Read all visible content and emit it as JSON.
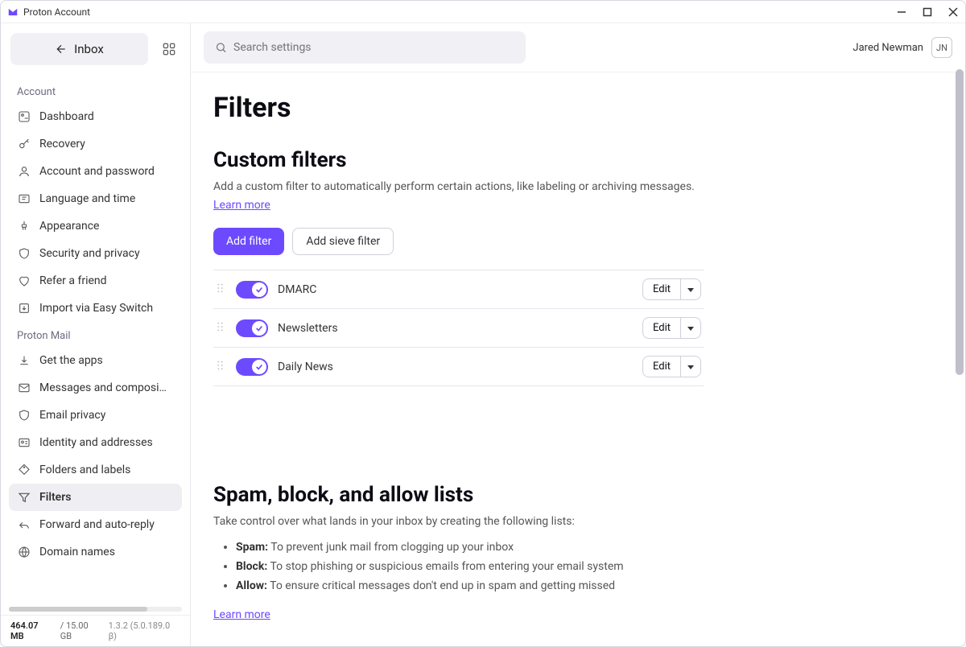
{
  "titlebar": {
    "app_name": "Proton Account"
  },
  "sidebar": {
    "inbox_label": "Inbox",
    "sections": {
      "account": {
        "title": "Account",
        "items": [
          {
            "id": "dashboard",
            "label": "Dashboard"
          },
          {
            "id": "recovery",
            "label": "Recovery"
          },
          {
            "id": "account-password",
            "label": "Account and password"
          },
          {
            "id": "language-time",
            "label": "Language and time"
          },
          {
            "id": "appearance",
            "label": "Appearance"
          },
          {
            "id": "security-privacy",
            "label": "Security and privacy"
          },
          {
            "id": "refer",
            "label": "Refer a friend"
          },
          {
            "id": "import",
            "label": "Import via Easy Switch"
          }
        ]
      },
      "mail": {
        "title": "Proton Mail",
        "items": [
          {
            "id": "get-apps",
            "label": "Get the apps"
          },
          {
            "id": "messages",
            "label": "Messages and composi…"
          },
          {
            "id": "email-privacy",
            "label": "Email privacy"
          },
          {
            "id": "identity",
            "label": "Identity and addresses"
          },
          {
            "id": "folders",
            "label": "Folders and labels"
          },
          {
            "id": "filters",
            "label": "Filters"
          },
          {
            "id": "forward",
            "label": "Forward and auto-reply"
          },
          {
            "id": "domains",
            "label": "Domain names"
          }
        ]
      }
    },
    "footer": {
      "used": "464.07 MB",
      "total": "/ 15.00 GB",
      "version": "1.3.2 (5.0.189.0 β)"
    }
  },
  "header": {
    "search_placeholder": "Search settings",
    "user_name": "Jared Newman",
    "user_initials": "JN"
  },
  "page": {
    "title": "Filters",
    "custom": {
      "heading": "Custom filters",
      "description": "Add a custom filter to automatically perform certain actions, like labeling or archiving messages.",
      "learn": "Learn more",
      "add_filter": "Add filter",
      "add_sieve": "Add sieve filter",
      "filters": [
        {
          "name": "DMARC",
          "edit": "Edit"
        },
        {
          "name": "Newsletters",
          "edit": "Edit"
        },
        {
          "name": "Daily News",
          "edit": "Edit"
        }
      ]
    },
    "spam": {
      "heading": "Spam, block, and allow lists",
      "description": "Take control over what lands in your inbox by creating the following lists:",
      "bullets": [
        {
          "term": "Spam:",
          "text": " To prevent junk mail from clogging up your inbox"
        },
        {
          "term": "Block:",
          "text": " To stop phishing or suspicious emails from entering your email system"
        },
        {
          "term": "Allow:",
          "text": " To ensure critical messages don't end up in spam and getting missed"
        }
      ],
      "learn": "Learn more"
    }
  }
}
